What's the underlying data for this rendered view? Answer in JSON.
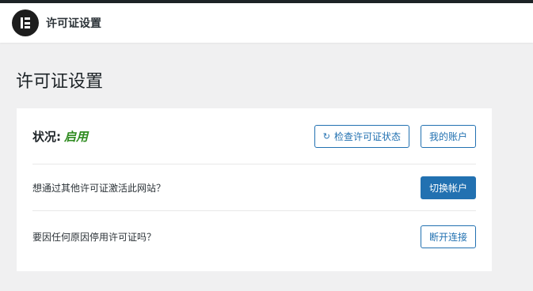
{
  "header": {
    "title": "许可证设置",
    "logo_icon": "elementor-logo-icon"
  },
  "page_title": "许可证设置",
  "status": {
    "label": "状况:",
    "value": "启用",
    "value_color": "#2e8b1f"
  },
  "buttons": {
    "check_license": "检查许可证状态",
    "my_account": "我的账户",
    "switch_account": "切换帐户",
    "disconnect": "断开连接"
  },
  "rows": {
    "switch_prompt": "想通过其他许可证激活此网站？",
    "disconnect_prompt": "要因任何原因停用许可证吗？"
  },
  "colors": {
    "accent": "#2271b1",
    "background": "#f0f0f1",
    "admin_bar": "#1d2327"
  }
}
